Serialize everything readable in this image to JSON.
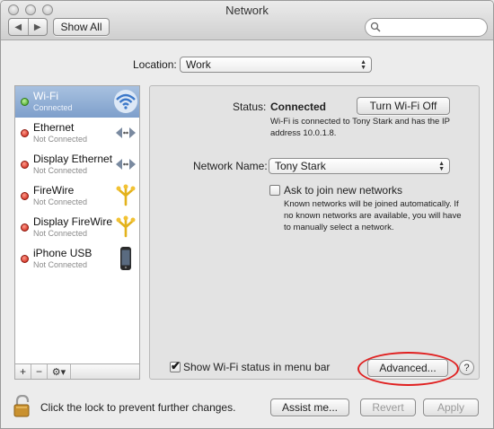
{
  "window": {
    "title": "Network"
  },
  "toolbar": {
    "show_all": "Show All",
    "search_placeholder": ""
  },
  "location": {
    "label": "Location:",
    "value": "Work"
  },
  "services": [
    {
      "name": "Wi-Fi",
      "state": "Connected",
      "status_color": "green",
      "icon": "wifi-icon",
      "selected": true
    },
    {
      "name": "Ethernet",
      "state": "Not Connected",
      "status_color": "red",
      "icon": "ethernet-icon",
      "selected": false
    },
    {
      "name": "Display Ethernet",
      "state": "Not Connected",
      "status_color": "red",
      "icon": "ethernet-icon",
      "selected": false
    },
    {
      "name": "FireWire",
      "state": "Not Connected",
      "status_color": "red",
      "icon": "firewire-icon",
      "selected": false
    },
    {
      "name": "Display FireWire",
      "state": "Not Connected",
      "status_color": "red",
      "icon": "firewire-icon",
      "selected": false
    },
    {
      "name": "iPhone USB",
      "state": "Not Connected",
      "status_color": "red",
      "icon": "iphone-icon",
      "selected": false
    }
  ],
  "sidebar_footer": {
    "add": "+",
    "remove": "−",
    "action": "⚙▾"
  },
  "detail": {
    "status_label": "Status:",
    "status_value": "Connected",
    "turn_off_button": "Turn Wi-Fi Off",
    "status_description": "Wi-Fi is connected to Tony Stark and has the IP address 10.0.1.8.",
    "network_name_label": "Network Name:",
    "network_name_value": "Tony Stark",
    "ask_to_join_label": "Ask to join new networks",
    "ask_to_join_checked": false,
    "ask_to_join_description": "Known networks will be joined automatically. If no known networks are available, you will have to manually select a network.",
    "show_status_label": "Show Wi-Fi status in menu bar",
    "show_status_checked": true,
    "advanced_button": "Advanced...",
    "help_button": "?"
  },
  "bottom": {
    "lock_text": "Click the lock to prevent further changes.",
    "assist_button": "Assist me...",
    "revert_button": "Revert",
    "apply_button": "Apply"
  },
  "colors": {
    "selection": "#8aa8d2",
    "connected": "#3b9e1b",
    "not_connected": "#c91a0d",
    "highlight_ring": "#e02020"
  }
}
